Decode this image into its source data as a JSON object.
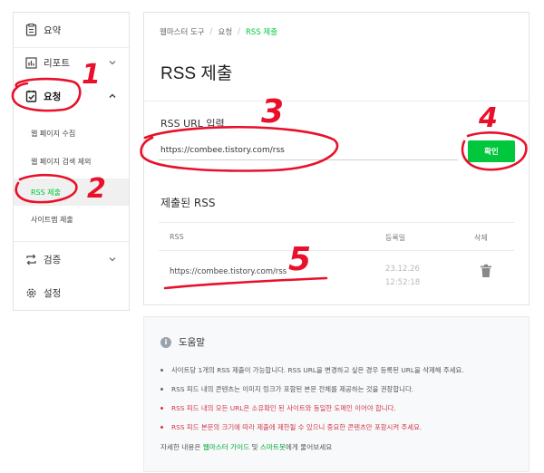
{
  "sidebar": {
    "items": [
      {
        "label": "요약",
        "icon": "document-icon"
      },
      {
        "label": "리포트",
        "icon": "chart-icon"
      },
      {
        "label": "요청",
        "icon": "checklist-icon"
      },
      {
        "label": "검증",
        "icon": "repeat-icon"
      },
      {
        "label": "설정",
        "icon": "gear-icon"
      }
    ],
    "subitems": [
      "웹 페이지 수집",
      "웹 페이지 검색 제외",
      "RSS 제출",
      "사이트맵 제출"
    ]
  },
  "breadcrumb": [
    "웹마스터 도구",
    "요청",
    "RSS 제출"
  ],
  "page_title": "RSS 제출",
  "form": {
    "label": "RSS URL 입력",
    "input_value": "https://combee.tistory.com/rss",
    "confirm_label": "확인"
  },
  "submitted": {
    "title": "제출된 RSS",
    "headers": [
      "RSS",
      "등록일",
      "삭제"
    ],
    "rows": [
      {
        "url": "https://combee.tistory.com/rss",
        "date": "23.12.26 12:52:18"
      }
    ]
  },
  "help": {
    "title": "도움말",
    "bullets": [
      "사이트당 1개의 RSS 제출이 가능합니다. RSS URL을 변경하고 싶은 경우 등록된 URL을 삭제해 주세요.",
      "RSS 피드 내의 콘텐츠는 이미지 링크가 포함된 본문 전체를 제공하는 것을 권장합니다.",
      "RSS 피드 내의 모든 URL은 소유확인 된 사이트와 동일한 도메인 이어야 합니다.",
      "RSS 피드 본문의 크기에 따라 제출에 제한될 수 있으니 중요한 콘텐츠만 포함시켜 주세요."
    ],
    "footer_prefix": "자세한 내용은 ",
    "footer_link1": "웹마스터 가이드",
    "footer_mid": " 및 ",
    "footer_link2": "스마트봇",
    "footer_suffix": "에게 물어보세요"
  },
  "annotations": [
    "1",
    "2",
    "3",
    "4",
    "5"
  ],
  "colors": {
    "accent": "#00c73c",
    "annotation": "#e8102a",
    "warning": "#d4374b"
  }
}
